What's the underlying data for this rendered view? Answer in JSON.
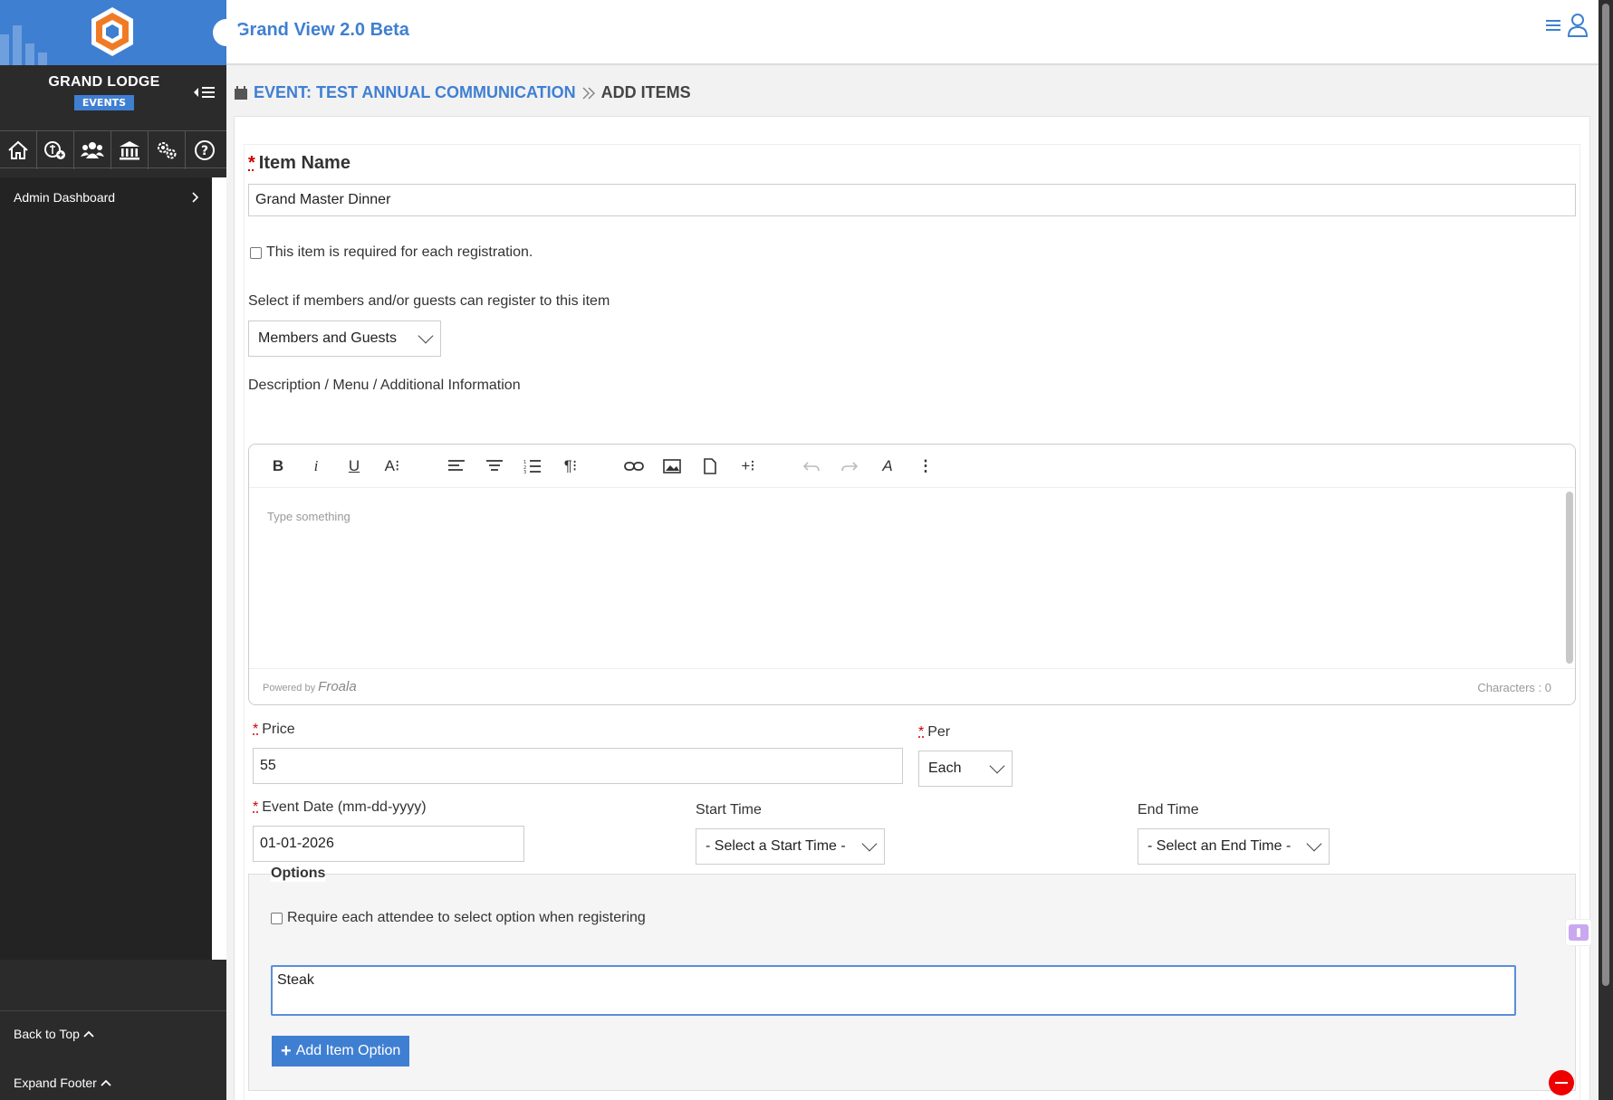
{
  "app": {
    "title": "Grand View 2.0 Beta"
  },
  "sidebar": {
    "org_name": "GRAND LODGE",
    "badge": "EVENTS",
    "icons": [
      "home-icon",
      "add-plan-icon",
      "members-icon",
      "lodge-building-icon",
      "settings-gears-icon",
      "help-icon"
    ],
    "menu": [
      {
        "label": "Admin Dashboard"
      }
    ],
    "back_to_top": "Back to Top",
    "expand_footer": "Expand Footer"
  },
  "breadcrumb": {
    "event": "EVENT: TEST ANNUAL COMMUNICATION",
    "separator": "»",
    "current": "ADD ITEMS"
  },
  "form": {
    "item_name_label": "Item Name",
    "item_name_value": "Grand Master Dinner",
    "required_checkbox_label": "This item is required for each registration.",
    "audience_label": "Select if members and/or guests can register to this item",
    "audience_value": "Members and Guests",
    "description_label": "Description / Menu / Additional Information",
    "editor": {
      "placeholder": "Type something",
      "powered_by": "Powered by",
      "brand": "Froala",
      "characters": "Characters : 0"
    },
    "price_label": "Price",
    "price_value": "55",
    "per_label": "Per",
    "per_value": "Each",
    "event_date_label": "Event Date (mm-dd-yyyy)",
    "event_date_value": "01-01-2026",
    "start_time_label": "Start Time",
    "start_time_value": "- Select a Start Time -",
    "end_time_label": "End Time",
    "end_time_value": "- Select an End Time -",
    "options": {
      "legend": "Options",
      "require_label": "Require each attendee to select option when registering",
      "option_value": "Steak",
      "add_button": "Add Item Option"
    }
  },
  "colors": {
    "accent": "#3f7fd2",
    "sidebar_bg": "#2b2b2b",
    "required": "#cc0000",
    "remove": "#ee0000"
  }
}
